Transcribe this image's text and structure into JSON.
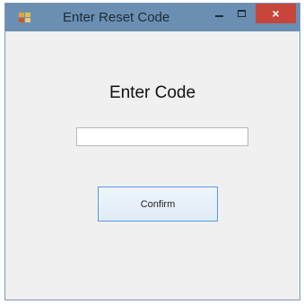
{
  "window": {
    "title": "Enter Reset Code",
    "close_label": "×"
  },
  "form": {
    "heading": "Enter Code",
    "code_input": {
      "value": "",
      "placeholder": ""
    },
    "confirm_label": "Confirm"
  },
  "icons": {
    "app": "app-icon",
    "minimize": "minimize-icon",
    "maximize": "maximize-icon",
    "close": "close-icon"
  },
  "colors": {
    "titlebar": "#6a8fb3",
    "close_button": "#c7453a",
    "window_background": "#f0f0f0",
    "button_border": "#4f9ae6"
  }
}
